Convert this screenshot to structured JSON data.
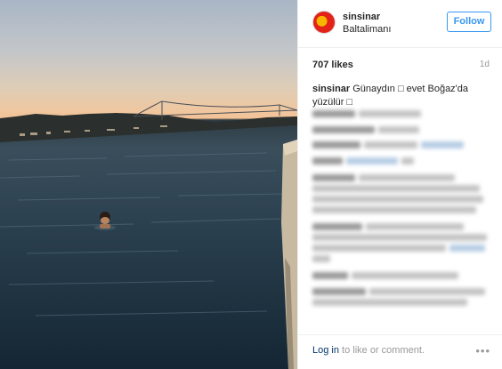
{
  "post": {
    "username": "sinsinar",
    "location": "Baltalimanı",
    "follow_label": "Follow",
    "likes": "707 likes",
    "age": "1d",
    "caption_user": "sinsinar",
    "caption_text": "Günaydın □ evet Boğaz'da yüzülür □"
  },
  "footer": {
    "login_label": "Log in",
    "login_rest": "to like or comment.",
    "more_icon": "•••"
  },
  "icons": {
    "avatar": "avatar",
    "more": "more-options-icon"
  },
  "colors": {
    "link_blue": "#3897f0",
    "login_blue": "#003569",
    "muted": "#999999",
    "sky_sunset": "#f3c296",
    "water": "#2c4150"
  }
}
